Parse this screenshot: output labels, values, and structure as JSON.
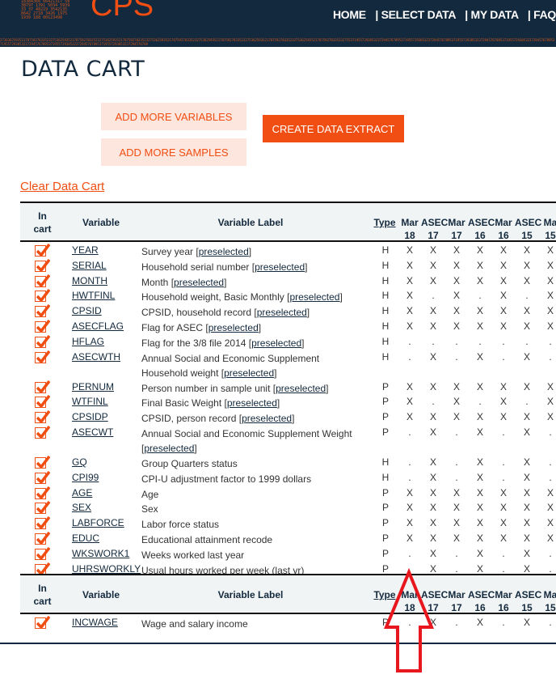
{
  "header": {
    "logo": "CPS",
    "nav": [
      "HOME",
      "| SELECT DATA",
      "| MY DATA",
      "| FAQ"
    ]
  },
  "page_title": "DATA CART",
  "buttons": {
    "add_variables": "ADD MORE VARIABLES",
    "add_samples": "ADD MORE SAMPLES",
    "create_extract": "CREATE DATA EXTRACT",
    "clear_cart": "Clear Data Cart"
  },
  "colors": {
    "accent": "#f04e12",
    "navy": "#13293d",
    "light_button": "#fde6dd"
  },
  "table": {
    "headers": {
      "in_cart": "In cart",
      "variable": "Variable",
      "label": "Variable Label",
      "type": "Type"
    },
    "samples": [
      [
        "Mar",
        "18"
      ],
      [
        "ASEC",
        "17"
      ],
      [
        "Mar",
        "17"
      ],
      [
        "ASEC",
        "16"
      ],
      [
        "Mar",
        "16"
      ],
      [
        "ASEC",
        "15"
      ],
      [
        "Ma",
        "15"
      ]
    ],
    "preselected_text": "preselected",
    "rows": [
      {
        "var": "YEAR",
        "label": "Survey year",
        "pre": true,
        "type": "H",
        "marks": "XXXXXXX"
      },
      {
        "var": "SERIAL",
        "label": "Household serial number",
        "pre": true,
        "type": "H",
        "marks": "XXXXXXX"
      },
      {
        "var": "MONTH",
        "label": "Month",
        "pre": true,
        "type": "H",
        "marks": "XXXXXXX"
      },
      {
        "var": "HWTFINL",
        "label": "Household weight, Basic Monthly",
        "pre": true,
        "type": "H",
        "marks": "X.X.X.X"
      },
      {
        "var": "CPSID",
        "label": "CPSID, household record",
        "pre": true,
        "type": "H",
        "marks": "XXXXXXX"
      },
      {
        "var": "ASECFLAG",
        "label": "Flag for ASEC",
        "pre": true,
        "type": "H",
        "marks": "XXXXXXX"
      },
      {
        "var": "HFLAG",
        "label": "Flag for the 3/8 file 2014",
        "pre": true,
        "type": "H",
        "marks": "......."
      },
      {
        "var": "ASECWTH",
        "label": "Annual Social and Economic Supplement Household weight",
        "pre": true,
        "type": "H",
        "marks": ".X.X.X.",
        "lines": 2
      },
      {
        "var": "PERNUM",
        "label": "Person number in sample unit",
        "pre": true,
        "type": "P",
        "marks": "XXXXXXX"
      },
      {
        "var": "WTFINL",
        "label": "Final Basic Weight",
        "pre": true,
        "type": "P",
        "marks": "X.X.X.X"
      },
      {
        "var": "CPSIDP",
        "label": "CPSID, person record",
        "pre": true,
        "type": "P",
        "marks": "XXXXXXX"
      },
      {
        "var": "ASECWT",
        "label": "Annual Social and Economic Supplement Weight",
        "pre": true,
        "type": "P",
        "marks": ".X.X.X.",
        "lines": 2
      },
      {
        "var": "GQ",
        "label": "Group Quarters status",
        "pre": false,
        "type": "H",
        "marks": ".X.X.X."
      },
      {
        "var": "CPI99",
        "label": "CPI-U adjustment factor to 1999 dollars",
        "pre": false,
        "type": "H",
        "marks": ".X.X.X."
      },
      {
        "var": "AGE",
        "label": "Age",
        "pre": false,
        "type": "P",
        "marks": "XXXXXXX"
      },
      {
        "var": "SEX",
        "label": "Sex",
        "pre": false,
        "type": "P",
        "marks": "XXXXXXX"
      },
      {
        "var": "LABFORCE",
        "label": "Labor force status",
        "pre": false,
        "type": "P",
        "marks": "XXXXXXX"
      },
      {
        "var": "EDUC",
        "label": "Educational attainment recode",
        "pre": false,
        "type": "P",
        "marks": "XXXXXXX"
      },
      {
        "var": "WKSWORK1",
        "label": "Weeks worked last year",
        "pre": false,
        "type": "P",
        "marks": ".X.X.X."
      },
      {
        "var": "UHRSWORKLY",
        "label": "Usual hours worked per week (last yr)",
        "pre": false,
        "type": "P",
        "marks": ".X.X.X."
      }
    ],
    "rows2": [
      {
        "var": "INCWAGE",
        "label": "Wage and salary income",
        "pre": false,
        "type": "P",
        "marks": ".X.X.X."
      }
    ]
  }
}
